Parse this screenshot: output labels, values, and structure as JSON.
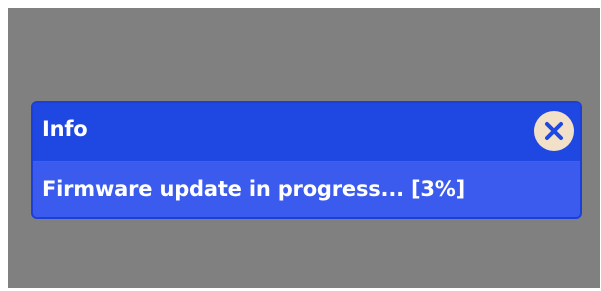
{
  "dialog": {
    "title": "Info",
    "message": "Firmware update in progress... [3%]",
    "progress_percent": 3,
    "close_icon": "close-icon"
  },
  "colors": {
    "backdrop": "#808080",
    "dialog_header": "#1f47e2",
    "dialog_body": "#3b5bef",
    "close_button": "#f2e0c8",
    "close_glyph": "#1f47e2"
  }
}
